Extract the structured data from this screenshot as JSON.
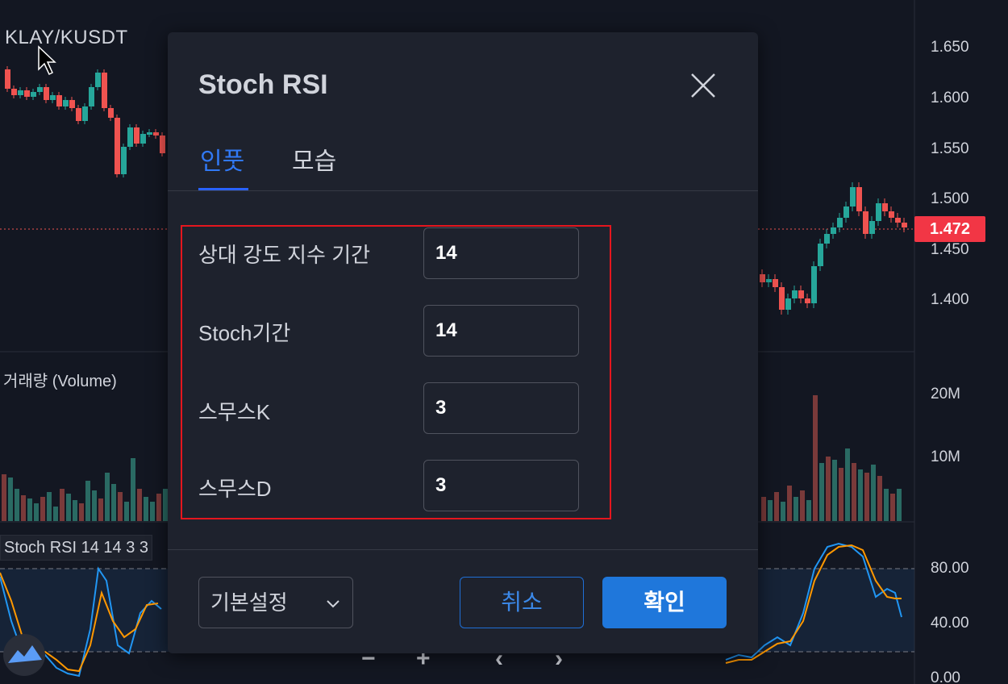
{
  "chart": {
    "symbol": "KLAY/KUSDT",
    "volume_label": "거래량 (Volume)",
    "rsi_label": "Stoch RSI 14 14 3 3",
    "price_ticks": [
      "1.650",
      "1.600",
      "1.550",
      "1.500",
      "1.450",
      "1.400"
    ],
    "current_price": "1.472",
    "volume_ticks": [
      "20M",
      "10M"
    ],
    "rsi_ticks": [
      "80.00",
      "40.00",
      "0.00"
    ],
    "colors": {
      "up": "#26a69a",
      "down": "#ef5350",
      "k_line": "#2196f3",
      "d_line": "#ff9800",
      "price_badge": "#f23645"
    },
    "nav": {
      "zoom_out": "−",
      "zoom_in": "+",
      "prev": "‹",
      "next": "›"
    }
  },
  "dialog": {
    "title": "Stoch RSI",
    "tabs": [
      {
        "label": "인풋",
        "active": true
      },
      {
        "label": "모습",
        "active": false
      }
    ],
    "fields": [
      {
        "label": "상대 강도 지수 기간",
        "value": "14"
      },
      {
        "label": "Stoch기간",
        "value": "14"
      },
      {
        "label": "스무스K",
        "value": "3"
      },
      {
        "label": "스무스D",
        "value": "3"
      }
    ],
    "preset_label": "기본설정",
    "cancel_label": "취소",
    "ok_label": "확인",
    "accent_color": "#2962ff",
    "highlight_color": "#e5161e"
  }
}
